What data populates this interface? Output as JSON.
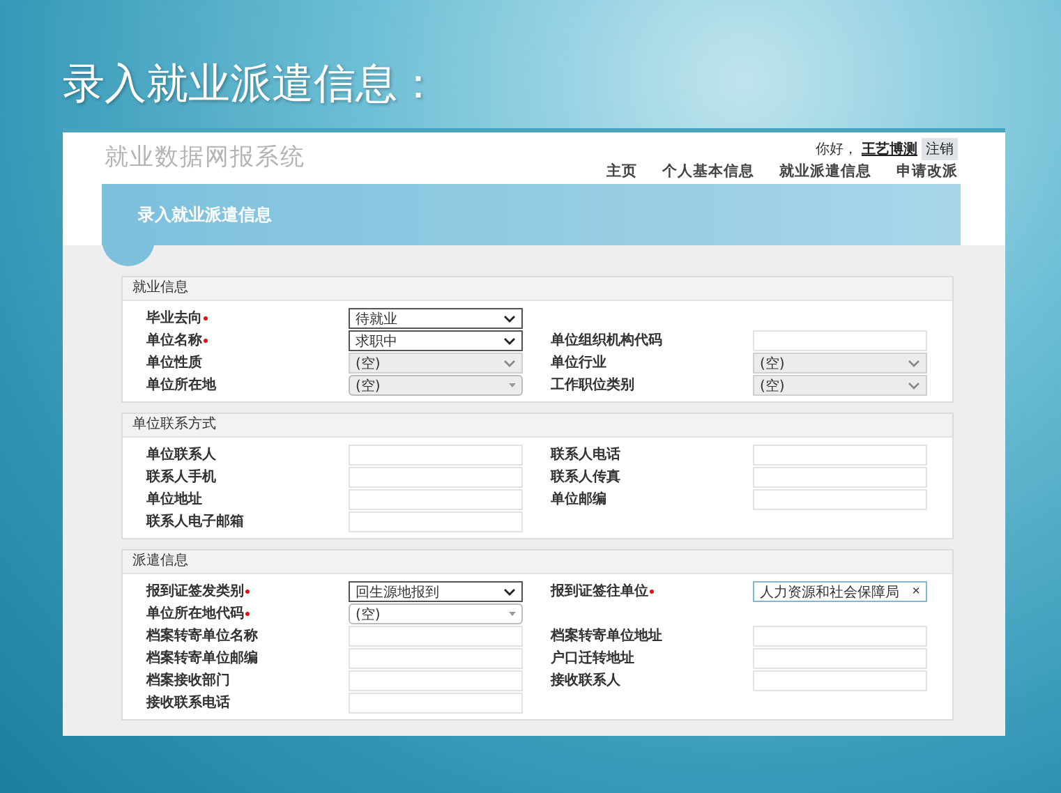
{
  "slide_title": "录入就业派遣信息：",
  "app": {
    "system_name": "就业数据网报系统",
    "greeting": "你好，",
    "user": "王艺博测",
    "logout": "注销",
    "nav": [
      {
        "label": "主页"
      },
      {
        "label": "个人基本信息"
      },
      {
        "label": "就业派遣信息"
      },
      {
        "label": "申请改派"
      }
    ],
    "page_title": "录入就业派遣信息"
  },
  "sections": [
    {
      "title": "就业信息",
      "rows": [
        [
          {
            "label": "毕业去向",
            "required": true,
            "kind": "select",
            "disabled": false,
            "value": "待就业"
          }
        ],
        [
          {
            "label": "单位名称",
            "required": true,
            "kind": "select",
            "disabled": false,
            "value": "求职中"
          },
          {
            "label": "单位组织机构代码",
            "required": false,
            "kind": "input"
          }
        ],
        [
          {
            "label": "单位性质",
            "required": false,
            "kind": "select",
            "disabled": true,
            "value": "(空)"
          },
          {
            "label": "单位行业",
            "required": false,
            "kind": "select",
            "disabled": true,
            "value": "(空)"
          }
        ],
        [
          {
            "label": "单位所在地",
            "required": false,
            "kind": "combo",
            "disabled": true,
            "value": "(空)"
          },
          {
            "label": "工作职位类别",
            "required": false,
            "kind": "select",
            "disabled": true,
            "value": "(空)"
          }
        ]
      ]
    },
    {
      "title": "单位联系方式",
      "rows": [
        [
          {
            "label": "单位联系人",
            "required": false,
            "kind": "input"
          },
          {
            "label": "联系人电话",
            "required": false,
            "kind": "input"
          }
        ],
        [
          {
            "label": "联系人手机",
            "required": false,
            "kind": "input"
          },
          {
            "label": "联系人传真",
            "required": false,
            "kind": "input"
          }
        ],
        [
          {
            "label": "单位地址",
            "required": false,
            "kind": "input"
          },
          {
            "label": "单位邮编",
            "required": false,
            "kind": "input"
          }
        ],
        [
          {
            "label": "联系人电子邮箱",
            "required": false,
            "kind": "input"
          }
        ]
      ]
    },
    {
      "title": "派遣信息",
      "rows": [
        [
          {
            "label": "报到证签发类别",
            "required": true,
            "kind": "select",
            "disabled": false,
            "value": "回生源地报到"
          },
          {
            "label": "报到证签往单位",
            "required": true,
            "kind": "clearable",
            "value": "人力资源和社会保障局",
            "clear": "×"
          }
        ],
        [
          {
            "label": "单位所在地代码",
            "required": true,
            "kind": "combo",
            "disabled": false,
            "value": "(空)"
          }
        ],
        [
          {
            "label": "档案转寄单位名称",
            "required": false,
            "kind": "input"
          },
          {
            "label": "档案转寄单位地址",
            "required": false,
            "kind": "input"
          }
        ],
        [
          {
            "label": "档案转寄单位邮编",
            "required": false,
            "kind": "input"
          },
          {
            "label": "户口迁转地址",
            "required": false,
            "kind": "input"
          }
        ],
        [
          {
            "label": "档案接收部门",
            "required": false,
            "kind": "input"
          },
          {
            "label": "接收联系人",
            "required": false,
            "kind": "input"
          }
        ],
        [
          {
            "label": "接收联系电话",
            "required": false,
            "kind": "input"
          }
        ]
      ]
    }
  ]
}
